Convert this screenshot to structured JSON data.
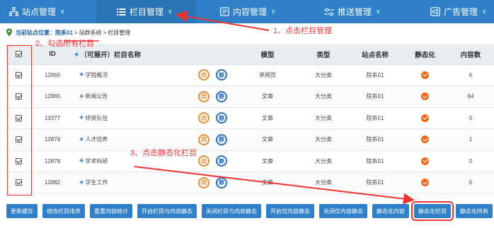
{
  "nav": {
    "items": [
      {
        "label": "站点管理",
        "icon": "sitemap-icon"
      },
      {
        "label": "栏目管理",
        "icon": "list-icon"
      },
      {
        "label": "内容管理",
        "icon": "document-icon"
      },
      {
        "label": "推送管理",
        "icon": "sliders-icon"
      },
      {
        "label": "广告管理",
        "icon": "megaphone-icon"
      }
    ],
    "active_index": 1
  },
  "breadcrumb": {
    "prefix": "当前站点位置：",
    "site": "院系01",
    "sep1": ">",
    "group": "站群系统",
    "sep2": ">",
    "page": "栏目管理"
  },
  "table": {
    "headers": {
      "id": "ID",
      "name": "（可展开）栏目名称",
      "model": "模型",
      "type": "类型",
      "site": "站点名称",
      "static": "静态化",
      "content": "内容数"
    },
    "rows": [
      {
        "id": "12860",
        "name": "学院概况",
        "model": "单网页",
        "type": "大分类",
        "site": "院系01",
        "count": "6"
      },
      {
        "id": "12865",
        "name": "新闻公告",
        "model": "文章",
        "type": "大分类",
        "site": "院系01",
        "count": "64"
      },
      {
        "id": "13377",
        "name": "师资队伍",
        "model": "文章",
        "type": "大分类",
        "site": "院系01",
        "count": "0"
      },
      {
        "id": "12874",
        "name": "人才培养",
        "model": "文章",
        "type": "大分类",
        "site": "院系01",
        "count": "1"
      },
      {
        "id": "12878",
        "name": "学术科研",
        "model": "文章",
        "type": "大分类",
        "site": "院系01",
        "count": "0"
      },
      {
        "id": "12882",
        "name": "学生工作",
        "model": "文章",
        "type": "大分类",
        "site": "院系01",
        "count": "0"
      }
    ],
    "action_edit_glyph": "改",
    "action_view_glyph": "静"
  },
  "buttons": [
    "更新缓存",
    "修改栏目排序",
    "重置内容统计",
    "开启栏目与内容静态",
    "关闭栏目与内容静态",
    "开启仅内容静态",
    "关闭仅内容静态",
    "静态化内容",
    "静态化栏目",
    "静态化所有"
  ],
  "highlighted_button_index": 8,
  "annotations": {
    "step1": "1、点击栏目管理",
    "step2": "2、勾选所有栏目",
    "step3": "3、点击静态化栏目"
  },
  "colors": {
    "nav_bg": "#2f80c8",
    "button_bg": "#2f80c8",
    "annotation_red": "#e33",
    "status_ok": "#f06a1d"
  }
}
